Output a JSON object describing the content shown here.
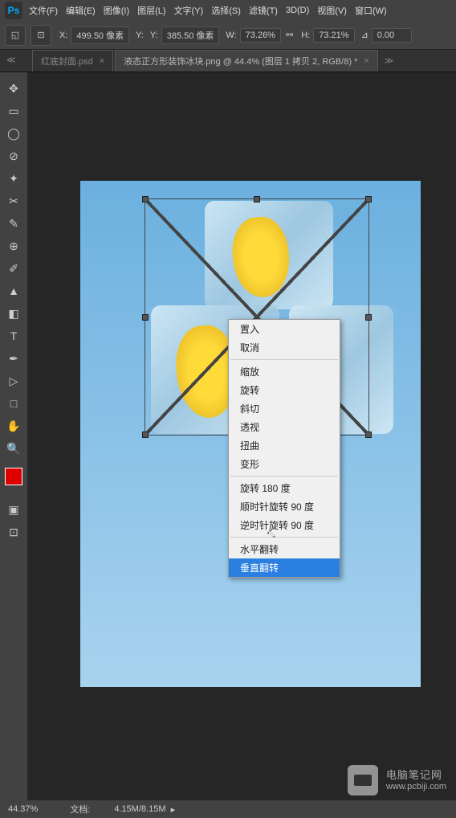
{
  "menu": {
    "items": [
      "文件(F)",
      "编辑(E)",
      "图像(I)",
      "图层(L)",
      "文字(Y)",
      "选择(S)",
      "滤镜(T)",
      "3D(D)",
      "视图(V)",
      "窗口(W)"
    ]
  },
  "options": {
    "x_lbl": "X:",
    "x": "499.50 像素",
    "y_lbl": "Y:",
    "y": "385.50 像素",
    "w_lbl": "W:",
    "w": "73.26%",
    "h_lbl": "H:",
    "h": "73.21%",
    "a_lbl": "⊿",
    "a": "0.00"
  },
  "tabs": {
    "tab1": "红底封面.psd",
    "tab2": "液态正方形装饰冰块.png @ 44.4% (图层 1 拷贝 2, RGB/8) *"
  },
  "context_menu": {
    "place": "置入",
    "cancel": "取消",
    "scale": "缩放",
    "rotate": "旋转",
    "skew": "斜切",
    "perspective": "透视",
    "warp": "扭曲",
    "distort": "变形",
    "rot180": "旋转 180 度",
    "rotcw": "顺时针旋转 90 度",
    "rotccw": "逆时针旋转 90 度",
    "fliph": "水平翻转",
    "flipv": "垂直翻转"
  },
  "status": {
    "zoom": "44.37%",
    "doc_lbl": "文档:",
    "doc": "4.15M/8.15M"
  },
  "watermark": {
    "title": "电脑笔记网",
    "url": "www.pcbiji.com"
  }
}
